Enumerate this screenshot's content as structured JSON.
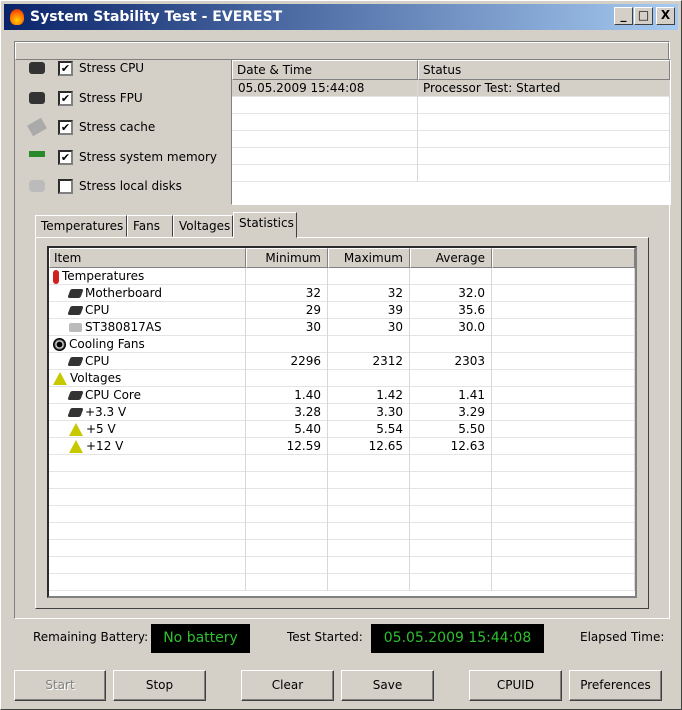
{
  "window": {
    "title": "System Stability Test - EVEREST",
    "min": "_",
    "max": "□",
    "close": "X"
  },
  "options": [
    {
      "label": "Stress CPU",
      "checked": true,
      "icon": "cpu-icon"
    },
    {
      "label": "Stress FPU",
      "checked": true,
      "icon": "fpu-icon"
    },
    {
      "label": "Stress cache",
      "checked": true,
      "icon": "cache-icon"
    },
    {
      "label": "Stress system memory",
      "checked": true,
      "icon": "memory-icon"
    },
    {
      "label": "Stress local disks",
      "checked": false,
      "icon": "disk-icon"
    }
  ],
  "log": {
    "headers": [
      "Date & Time",
      "Status"
    ],
    "rows": [
      [
        "05.05.2009 15:44:08",
        "Processor Test: Started"
      ]
    ]
  },
  "tabs": [
    "Temperatures",
    "Fans",
    "Voltages",
    "Statistics"
  ],
  "active_tab": "Statistics",
  "stats": {
    "headers": [
      "Item",
      "Minimum",
      "Maximum",
      "Average"
    ],
    "rows": [
      {
        "item": "Temperatures",
        "level": 0,
        "icon": "thermometer-icon",
        "min": "",
        "max": "",
        "avg": ""
      },
      {
        "item": "Motherboard",
        "level": 1,
        "icon": "motherboard-icon",
        "min": "32",
        "max": "32",
        "avg": "32.0"
      },
      {
        "item": "CPU",
        "level": 1,
        "icon": "cpu-icon",
        "min": "29",
        "max": "39",
        "avg": "35.6"
      },
      {
        "item": "ST380817AS",
        "level": 1,
        "icon": "disk-icon",
        "min": "30",
        "max": "30",
        "avg": "30.0"
      },
      {
        "item": "Cooling Fans",
        "level": 0,
        "icon": "fan-icon",
        "min": "",
        "max": "",
        "avg": ""
      },
      {
        "item": "CPU",
        "level": 1,
        "icon": "cpu-icon",
        "min": "2296",
        "max": "2312",
        "avg": "2303"
      },
      {
        "item": "Voltages",
        "level": 0,
        "icon": "voltage-icon",
        "min": "",
        "max": "",
        "avg": ""
      },
      {
        "item": "CPU Core",
        "level": 1,
        "icon": "cpu-icon",
        "min": "1.40",
        "max": "1.42",
        "avg": "1.41"
      },
      {
        "item": "+3.3 V",
        "level": 1,
        "icon": "cpu-icon",
        "min": "3.28",
        "max": "3.30",
        "avg": "3.29"
      },
      {
        "item": "+5 V",
        "level": 1,
        "icon": "voltage-icon",
        "min": "5.40",
        "max": "5.54",
        "avg": "5.50"
      },
      {
        "item": "+12 V",
        "level": 1,
        "icon": "voltage-icon",
        "min": "12.59",
        "max": "12.65",
        "avg": "12.63"
      }
    ]
  },
  "status": {
    "battery_label": "Remaining Battery:",
    "battery_value": "No battery",
    "started_label": "Test Started:",
    "started_value": "05.05.2009 15:44:08",
    "elapsed_label": "Elapsed Time:"
  },
  "buttons": {
    "start": "Start",
    "stop": "Stop",
    "clear": "Clear",
    "save": "Save",
    "cpuid": "CPUID",
    "preferences": "Preferences"
  }
}
